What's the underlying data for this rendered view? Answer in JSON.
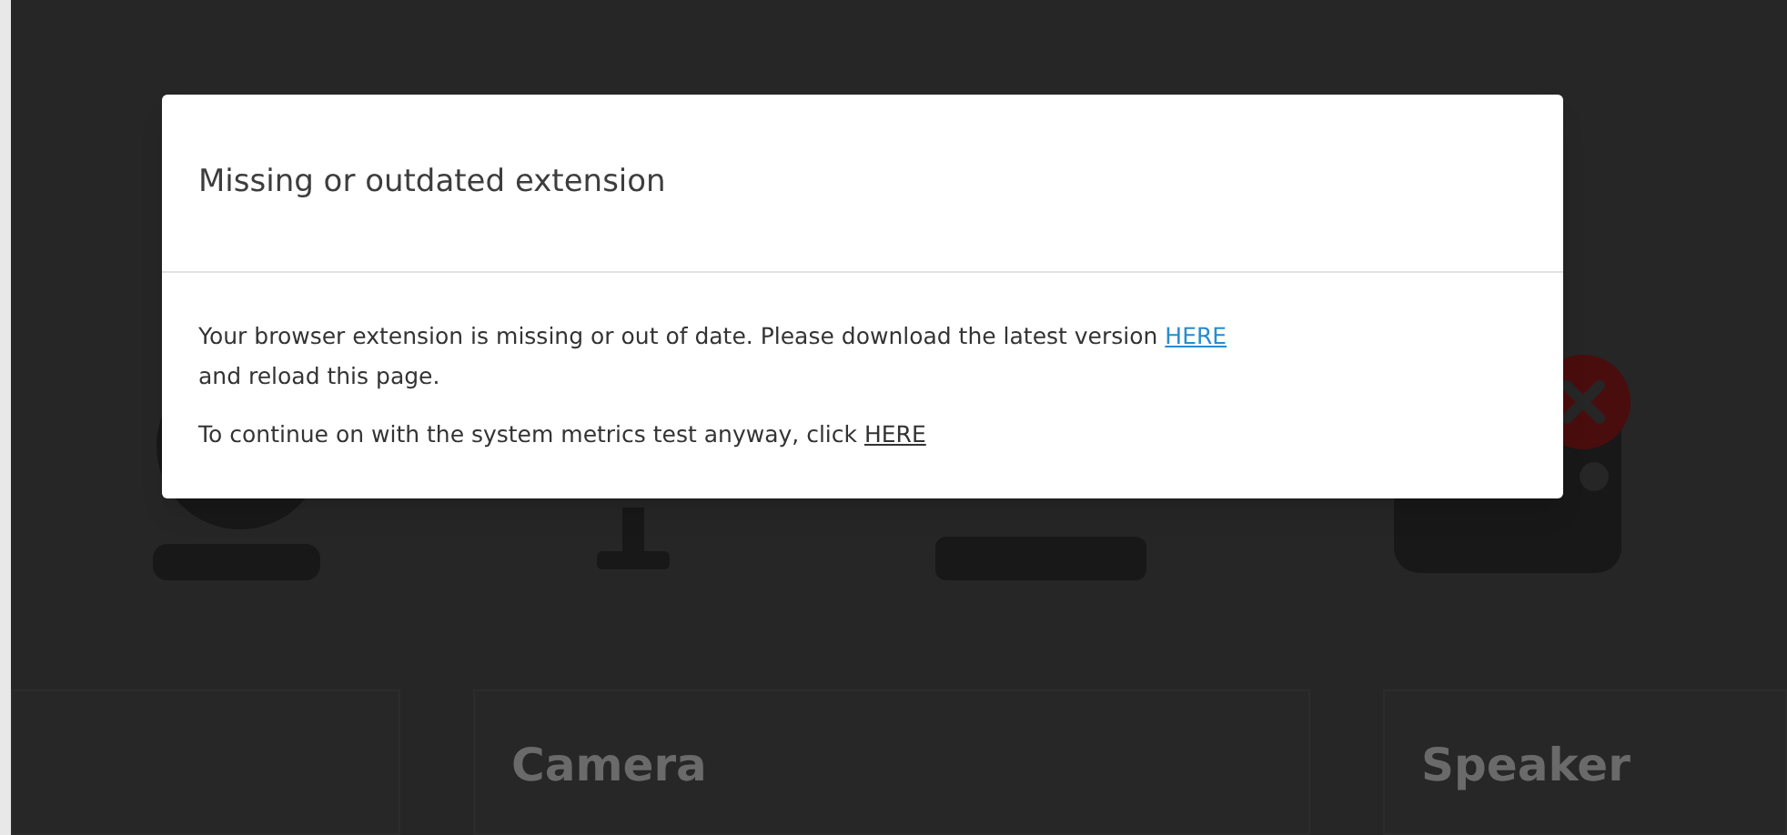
{
  "cards": [
    {
      "title": "Camera"
    },
    {
      "title": "Speaker"
    }
  ],
  "modal": {
    "title": "Missing or outdated extension",
    "paragraphs": [
      {
        "text": "Your browser extension is missing or out of date. Please download the latest version",
        "link": "HERE",
        "highlighted": true,
        "after": "and reload this page."
      },
      {
        "text": "To continue on with the system metrics test anyway, click",
        "link": "HERE",
        "highlighted": false
      }
    ]
  }
}
